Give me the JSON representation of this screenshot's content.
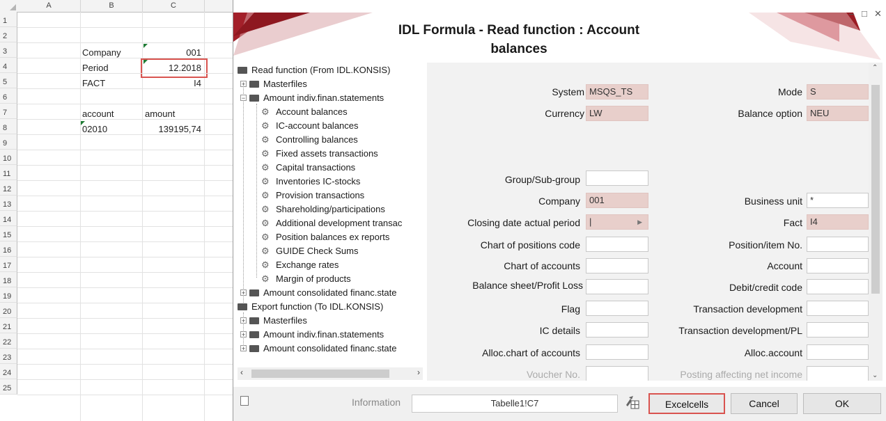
{
  "sheet": {
    "columns": [
      "A",
      "B",
      "C"
    ],
    "rows": [
      "1",
      "2",
      "3",
      "4",
      "5",
      "6",
      "7",
      "8",
      "9",
      "10",
      "11",
      "12",
      "13",
      "14",
      "15",
      "16",
      "17",
      "18",
      "19",
      "20",
      "21",
      "22",
      "23",
      "24",
      "25"
    ],
    "cells": {
      "b2": "Company",
      "c2": "001",
      "b3": "Period",
      "c3": "12.2018",
      "b4": "FACT",
      "c4": "I4",
      "b6": "account",
      "c6": "amount",
      "b7": "02010",
      "c7": "139195,74"
    }
  },
  "dialog": {
    "title": "IDL Formula - Read function : Account balances",
    "window_controls": {
      "minimize": "–",
      "maximize": "□",
      "close": "✕"
    },
    "tree": {
      "root_read": "Read function (From IDL.KONSIS)",
      "masterfiles": "Masterfiles",
      "amount_indiv": "Amount indiv.finan.statements",
      "children": [
        "Account balances",
        "IC-account balances",
        "Controlling balances",
        "Fixed assets transactions",
        "Capital transactions",
        "Inventories IC-stocks",
        "Provision transactions",
        "Shareholding/participations",
        "Additional development transac",
        "Position balances ex reports",
        "GUIDE Check Sums",
        "Exchange rates",
        "Margin of products"
      ],
      "amount_consolidated": "Amount consolidated financ.state",
      "root_export": "Export function (To IDL.KONSIS)",
      "export_masterfiles": "Masterfiles",
      "export_amount_indiv": "Amount indiv.finan.statements",
      "export_amount_consolidated": "Amount consolidated financ.state"
    },
    "form": {
      "system": {
        "label": "System",
        "value": "MSQS_TS"
      },
      "mode": {
        "label": "Mode",
        "value": "S"
      },
      "currency": {
        "label": "Currency",
        "value": "LW"
      },
      "balance_option": {
        "label": "Balance option",
        "value": "NEU"
      },
      "group": {
        "label": "Group/Sub-group",
        "value": ""
      },
      "company": {
        "label": "Company",
        "value": "001"
      },
      "business_unit": {
        "label": "Business unit",
        "value": "*"
      },
      "closing_date": {
        "label": "Closing date actual period",
        "value": "|"
      },
      "fact": {
        "label": "Fact",
        "value": "I4"
      },
      "chart_positions": {
        "label": "Chart of positions code",
        "value": ""
      },
      "position_item": {
        "label": "Position/item No.",
        "value": ""
      },
      "chart_accounts": {
        "label": "Chart of accounts",
        "value": ""
      },
      "account": {
        "label": "Account",
        "value": ""
      },
      "balance_sheet": {
        "label": "Balance sheet/Profit  Loss",
        "value": ""
      },
      "debit_credit": {
        "label": "Debit/credit code",
        "value": ""
      },
      "flag": {
        "label": "Flag",
        "value": ""
      },
      "transaction_dev": {
        "label": "Transaction development",
        "value": ""
      },
      "ic_details": {
        "label": "IC details",
        "value": ""
      },
      "transaction_dev_pl": {
        "label": "Transaction development/PL",
        "value": ""
      },
      "alloc_chart": {
        "label": "Alloc.chart of accounts",
        "value": ""
      },
      "alloc_account": {
        "label": "Alloc.account",
        "value": ""
      },
      "voucher": {
        "label": "Voucher No.",
        "value": ""
      },
      "posting": {
        "label": "Posting affecting net income",
        "value": ""
      }
    },
    "bottom": {
      "information_label": "Information",
      "information_value": "Tabelle1!C7",
      "excelcells": "Excelcells",
      "cancel": "Cancel",
      "ok": "OK"
    }
  },
  "colors": {
    "highlight": "#d9534f",
    "field_pink": "#e8cfcb",
    "banner_red": "#9b1c24"
  }
}
